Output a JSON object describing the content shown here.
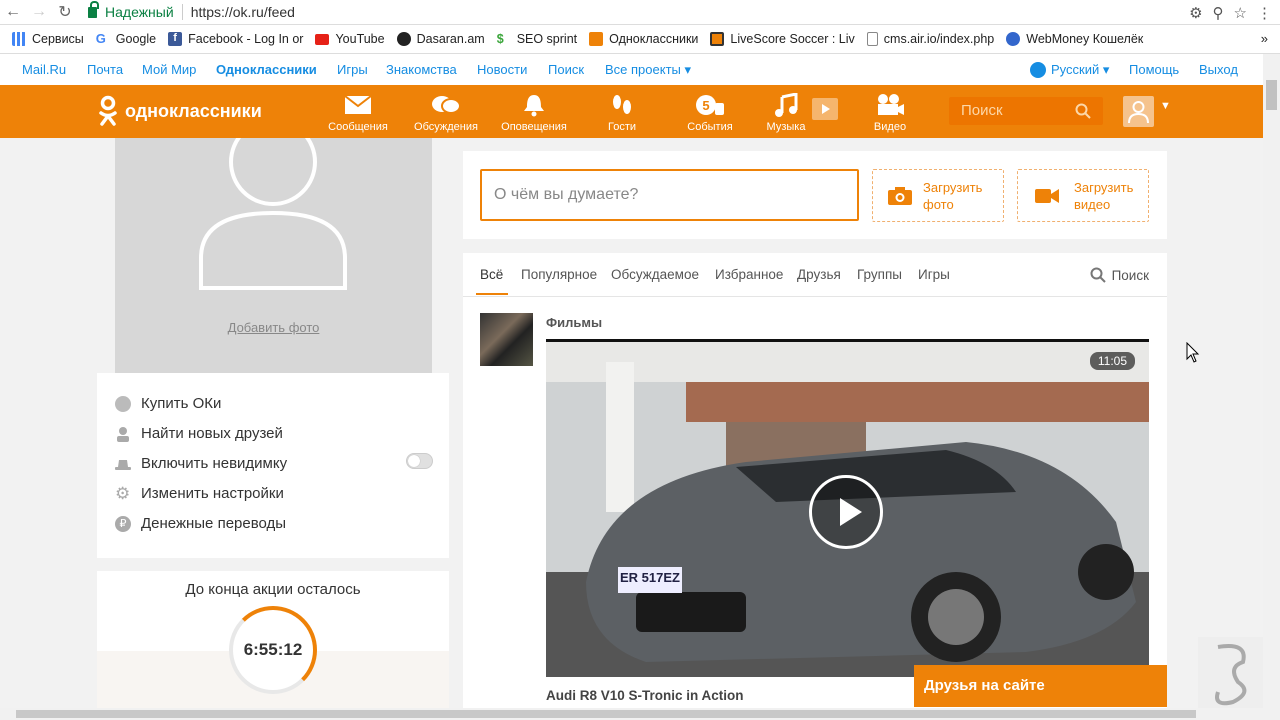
{
  "browser": {
    "secure_label": "Надежный",
    "url": "https://ok.ru/feed"
  },
  "bookmarks": [
    {
      "label": "Сервисы",
      "color": "#4285f4"
    },
    {
      "label": "Google",
      "color": "#ffffff"
    },
    {
      "label": "Facebook - Log In or",
      "color": "#3b5998"
    },
    {
      "label": "YouTube",
      "color": "#e62117"
    },
    {
      "label": "Dasaran.am",
      "color": "#222222"
    },
    {
      "label": "SEO sprint",
      "color": "#3aa53a"
    },
    {
      "label": "Одноклассники",
      "color": "#ee8208"
    },
    {
      "label": "LiveScore Soccer : Liv",
      "color": "#ee8208"
    },
    {
      "label": "cms.air.io/index.php",
      "color": "#ffffff"
    },
    {
      "label": "WebMoney Кошелёк",
      "color": "#3366cc"
    }
  ],
  "mailbar": {
    "items": [
      "Mail.Ru",
      "Почта",
      "Мой Мир",
      "Одноклассники",
      "Игры",
      "Знакомства",
      "Новости",
      "Поиск",
      "Все проекты ▾"
    ],
    "language": "Русский ▾",
    "help": "Помощь",
    "logout": "Выход"
  },
  "header": {
    "logo_text": "одноклассники",
    "nav": [
      "Сообщения",
      "Обсуждения",
      "Оповещения",
      "Гости",
      "События",
      "Музыка",
      "Видео"
    ],
    "search_placeholder": "Поиск",
    "accent": "#ee8208"
  },
  "sidebar": {
    "add_photo": "Добавить фото",
    "menu": [
      "Купить ОКи",
      "Найти новых друзей",
      "Включить невидимку",
      "Изменить настройки",
      "Денежные переводы"
    ],
    "promo_title": "До конца акции осталось",
    "timer": "6:55:12"
  },
  "post": {
    "placeholder": "О чём вы думаете?",
    "upload_photo": [
      "Загрузить",
      "фото"
    ],
    "upload_video": [
      "Загрузить",
      "видео"
    ]
  },
  "feed": {
    "tabs": [
      "Всё",
      "Популярное",
      "Обсуждаемое",
      "Избранное",
      "Друзья",
      "Группы",
      "Игры"
    ],
    "search": "Поиск",
    "author": "Фильмы",
    "duration": "11:05",
    "video_title": "Audi R8 V10 S-Tronic in Action",
    "plate": "ER 517EZ"
  },
  "friends_online": "Друзья на сайте"
}
